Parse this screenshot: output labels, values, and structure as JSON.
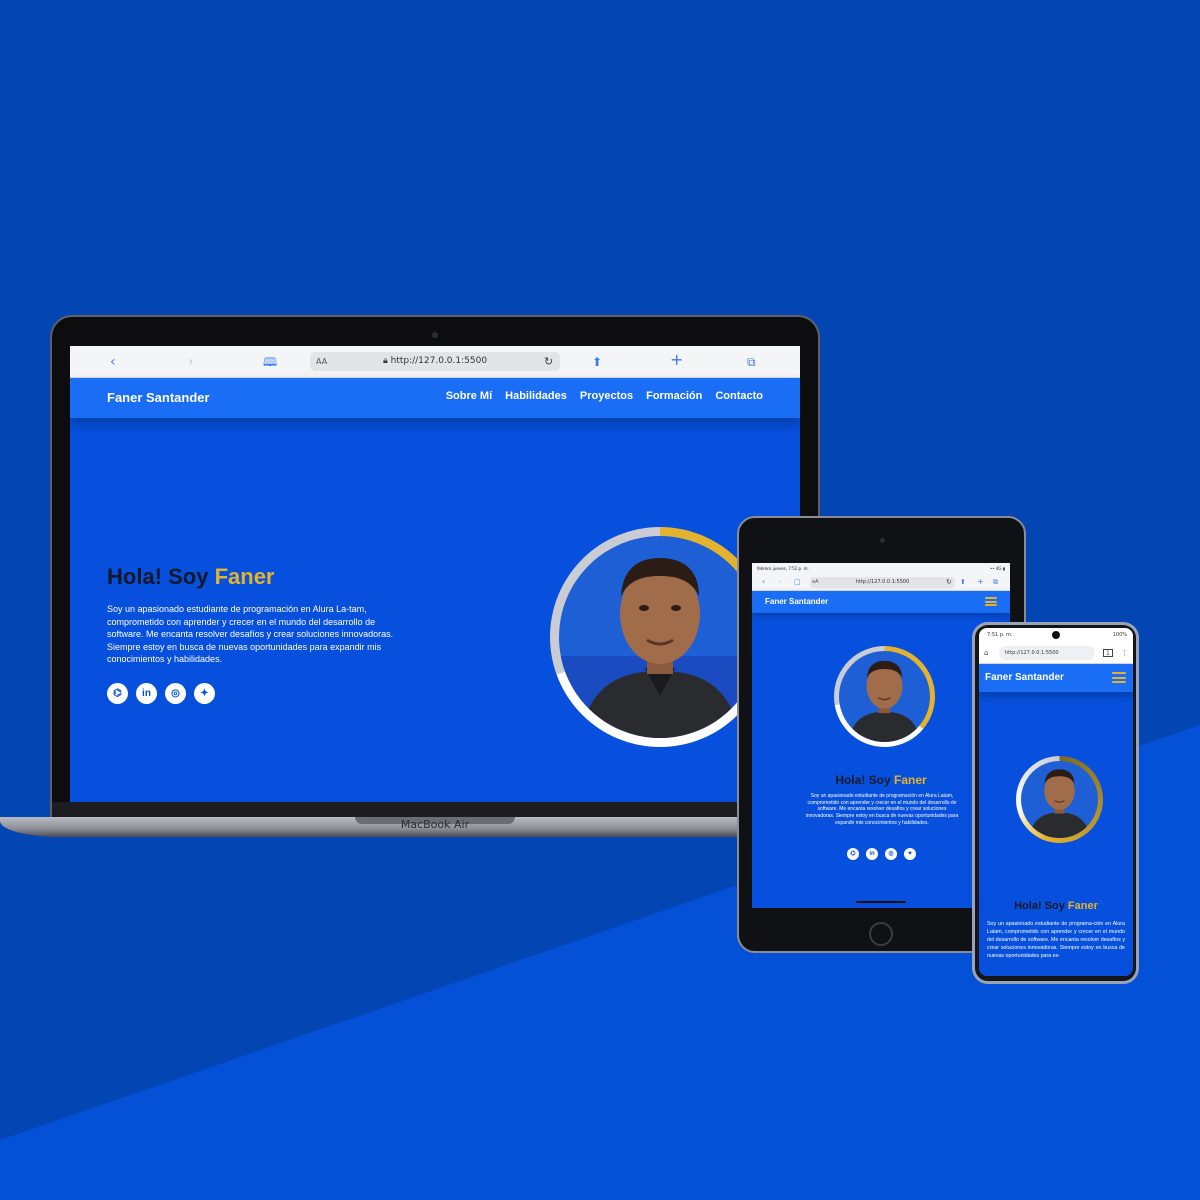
{
  "colors": {
    "background": "#0245b3",
    "background_lower": "#0450d6",
    "site_background": "#0750de",
    "nav_background": "#1a6ef5",
    "accent": "#e3b22f",
    "title_dark": "#111827",
    "text": "#ffffff"
  },
  "laptop": {
    "brand_label": "MacBook Air",
    "browser": {
      "url": "http://127.0.0.1:5500",
      "text_size_label": "AA",
      "icons": [
        "back-icon",
        "forward-icon",
        "bookmarks-icon",
        "reload-icon",
        "share-icon",
        "plus-icon",
        "tabs-icon"
      ]
    },
    "site": {
      "brand": "Faner Santander",
      "nav": [
        "Sobre Mí",
        "Habilidades",
        "Proyectos",
        "Formación",
        "Contacto"
      ],
      "hero": {
        "greeting": "Hola! Soy ",
        "name": "Faner",
        "text": "Soy un apasionado estudiante de programación en Alura La-tam, comprometido con aprender y crecer en el mundo del desarrollo de software. Me encanta resolver desafíos y crear soluciones innovadoras. Siempre estoy en busca de nuevas oportunidades para expandir mis conocimientos y habilidades."
      },
      "socials": [
        {
          "name": "github-icon",
          "glyph": "⌬"
        },
        {
          "name": "linkedin-icon",
          "glyph": "in"
        },
        {
          "name": "instagram-icon",
          "glyph": "◎"
        },
        {
          "name": "twitter-icon",
          "glyph": "✦"
        }
      ]
    }
  },
  "tablet": {
    "status_left": "febrero jueves, 7:52 p. m.",
    "status_right": "•• 4G ▮",
    "browser": {
      "url": "http://127.0.0.1:5500",
      "text_size_label": "aA"
    },
    "site": {
      "brand": "Faner Santander",
      "greeting": "Hola! Soy ",
      "name": "Faner",
      "text": "Soy un apasionado estudiante de programación en Alura Latam, comprometido con aprender y crecer en el mundo del desarrollo de software. Me encanta resolver desafíos y crear soluciones innovadoras. Siempre estoy en busca de nuevas oportunidades para expandir mis conocimientos y habilidades."
    }
  },
  "phone": {
    "status_left": "7:51 p. m.",
    "status_right": "100%",
    "browser": {
      "url": "http://127.0.0.1:5500",
      "tab_count": "1"
    },
    "site": {
      "brand": "Faner Santander",
      "greeting": "Hola! Soy ",
      "name": "Faner",
      "text": "Soy un apasionado estudiante de programa-ción en Alura Latam, comprometido con aprender y crecer en el mundo del desarrollo de software. Me encanta resolver desafíos y crear soluciones innovadoras. Siempre estoy en busca de nuevas oportunidades para ex-"
    }
  }
}
